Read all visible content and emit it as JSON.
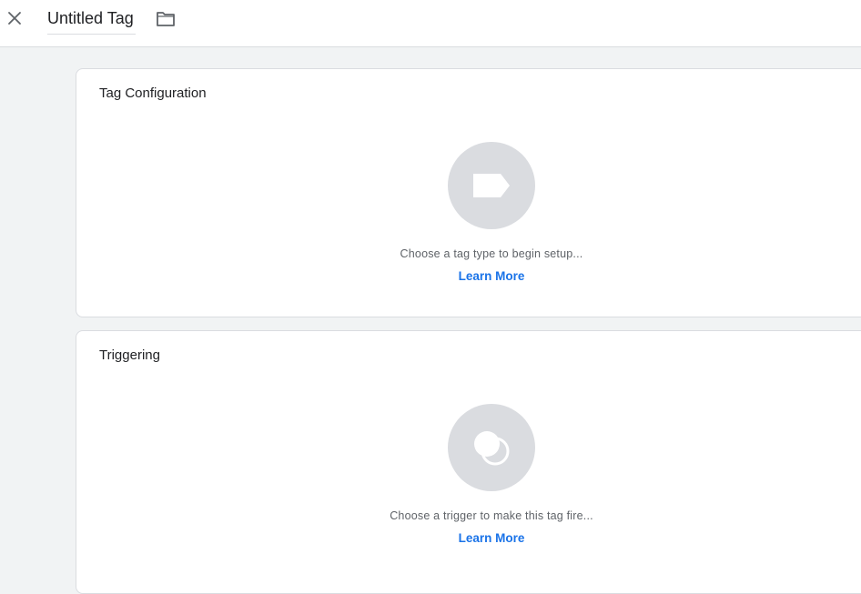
{
  "header": {
    "close_icon": "close-icon",
    "title": "Untitled Tag",
    "folder_icon": "folder-icon"
  },
  "tag_configuration": {
    "title": "Tag Configuration",
    "icon": "tag-icon",
    "hint": "Choose a tag type to begin setup...",
    "learn_more": "Learn More"
  },
  "triggering": {
    "title": "Triggering",
    "icon": "trigger-icon",
    "hint": "Choose a trigger to make this tag fire...",
    "learn_more": "Learn More"
  },
  "colors": {
    "link": "#1a73e8",
    "placeholder_bg": "#dadce0",
    "page_bg": "#f1f3f4"
  }
}
